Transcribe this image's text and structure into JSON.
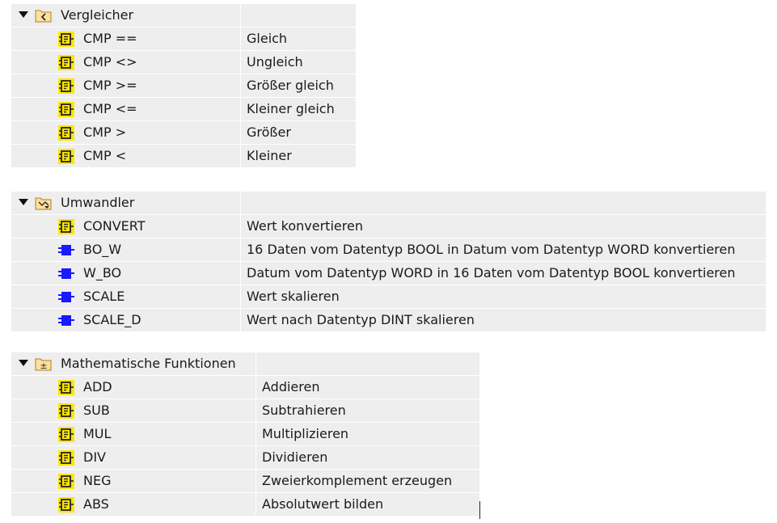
{
  "groups": [
    {
      "label": "Vergleicher",
      "icon": "comparator-folder-icon",
      "items": [
        {
          "name": "CMP ==",
          "desc": "Gleich",
          "icon": "box-instruction-icon"
        },
        {
          "name": "CMP <>",
          "desc": "Ungleich",
          "icon": "box-instruction-icon"
        },
        {
          "name": "CMP >=",
          "desc": "Größer gleich",
          "icon": "box-instruction-icon"
        },
        {
          "name": "CMP <=",
          "desc": "Kleiner gleich",
          "icon": "box-instruction-icon"
        },
        {
          "name": "CMP >",
          "desc": "Größer",
          "icon": "box-instruction-icon"
        },
        {
          "name": "CMP <",
          "desc": "Kleiner",
          "icon": "box-instruction-icon"
        }
      ]
    },
    {
      "label": "Umwandler",
      "icon": "converter-folder-icon",
      "items": [
        {
          "name": "CONVERT",
          "desc": "Wert konvertieren",
          "icon": "box-instruction-icon"
        },
        {
          "name": "BO_W",
          "desc": "16 Daten vom Datentyp BOOL in Datum vom Datentyp WORD konvertieren",
          "icon": "function-block-icon"
        },
        {
          "name": "W_BO",
          "desc": "Datum vom Datentyp WORD in 16 Daten vom Datentyp BOOL konvertieren",
          "icon": "function-block-icon"
        },
        {
          "name": "SCALE",
          "desc": "Wert skalieren",
          "icon": "function-block-icon"
        },
        {
          "name": "SCALE_D",
          "desc": "Wert nach Datentyp DINT skalieren",
          "icon": "function-block-icon"
        }
      ]
    },
    {
      "label": "Mathematische Funktionen",
      "icon": "math-folder-icon",
      "items": [
        {
          "name": "ADD",
          "desc": "Addieren",
          "icon": "box-instruction-icon"
        },
        {
          "name": "SUB",
          "desc": "Subtrahieren",
          "icon": "box-instruction-icon"
        },
        {
          "name": "MUL",
          "desc": "Multiplizieren",
          "icon": "box-instruction-icon"
        },
        {
          "name": "DIV",
          "desc": "Dividieren",
          "icon": "box-instruction-icon"
        },
        {
          "name": "NEG",
          "desc": "Zweierkomplement erzeugen",
          "icon": "box-instruction-icon"
        },
        {
          "name": "ABS",
          "desc": "Absolutwert bilden",
          "icon": "box-instruction-icon"
        }
      ]
    }
  ],
  "colors": {
    "row_bg": "#eeeeee",
    "grid_line": "#ffffff",
    "box_icon_yellow": "#ffe600",
    "fb_icon_blue": "#1a1aff",
    "folder_fill": "#fbe0a0"
  }
}
